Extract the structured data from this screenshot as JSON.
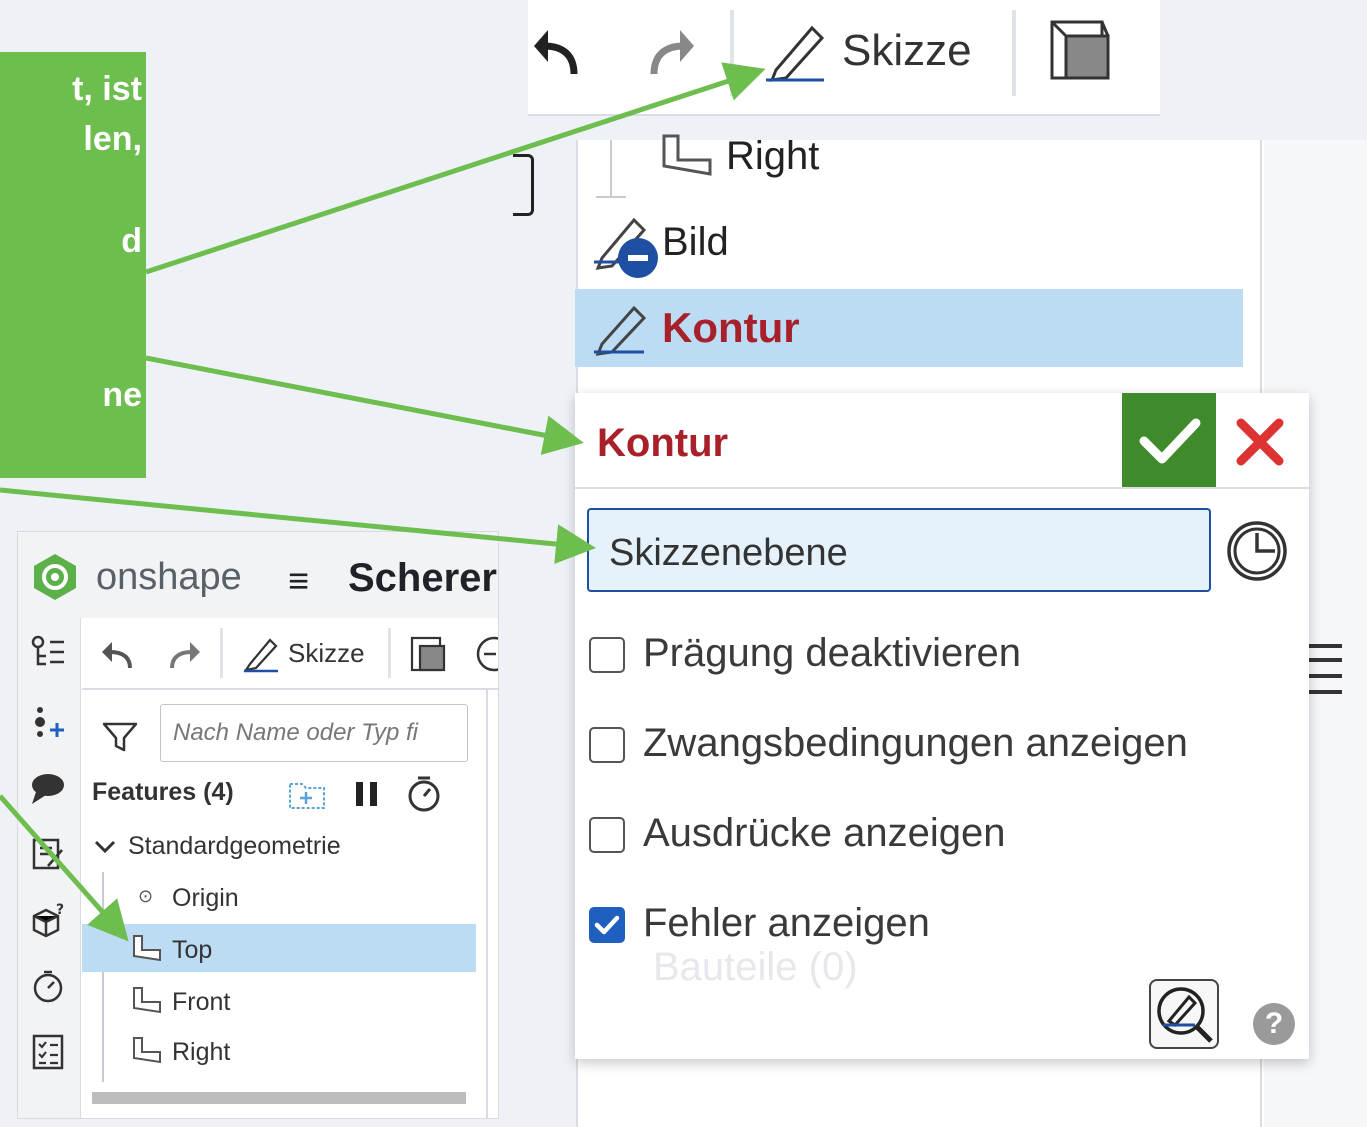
{
  "callout": {
    "lines": [
      "t, ist",
      "len,",
      "d",
      "ne"
    ],
    "color": "#6ebd4f"
  },
  "toolbar": {
    "undo_icon": "undo-icon",
    "redo_icon": "redo-icon",
    "sketch_label": "Skizze",
    "part_studio_icon": "cube-icon"
  },
  "tree": {
    "items": [
      {
        "label": "Right",
        "icon": "plane-icon"
      },
      {
        "label": "Bild",
        "icon": "sketch-suppressed-icon"
      },
      {
        "label": "Kontur",
        "icon": "sketch-icon",
        "selected": true
      }
    ]
  },
  "dialog": {
    "title": "Kontur",
    "ok_icon": "check-icon",
    "cancel_icon": "close-icon",
    "sketch_plane": "Skizzenebene",
    "options": [
      {
        "label": "Prägung deaktivieren",
        "checked": false
      },
      {
        "label": "Zwangsbedingungen anzeigen",
        "checked": false
      },
      {
        "label": "Ausdrücke anzeigen",
        "checked": false
      },
      {
        "label": "Fehler anzeigen",
        "checked": true
      }
    ],
    "ghost_text": "Bauteile (0)",
    "help": "?"
  },
  "mini": {
    "brand": "onshape",
    "menu": "≡",
    "doc_title": "Scherer",
    "sketch_label": "Skizze",
    "search_placeholder": "Nach Name oder Typ fi",
    "features_label": "Features (4)",
    "group_label": "Standardgeometrie",
    "items": [
      "Origin",
      "Top",
      "Front",
      "Right"
    ],
    "selected": "Top"
  },
  "colors": {
    "accent_green": "#6ebd4f",
    "ok_green": "#3f8a2a",
    "title_red": "#a8202a",
    "selection_blue": "#bcdcf3",
    "check_blue": "#1f5fbf"
  }
}
